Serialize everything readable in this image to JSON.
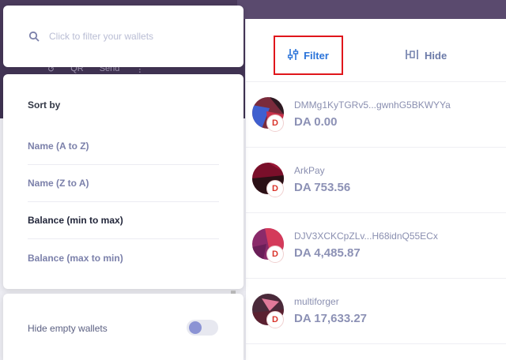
{
  "search": {
    "placeholder": "Click to filter your wallets"
  },
  "background": {
    "actions": [
      "↺",
      "QR",
      "Send",
      "⋮"
    ]
  },
  "toolbar": {
    "filter_label": "Filter",
    "hide_label": "Hide"
  },
  "sort": {
    "title": "Sort by",
    "options": [
      {
        "label": "Name (A to Z)",
        "active": false
      },
      {
        "label": "Name (Z to A)",
        "active": false
      },
      {
        "label": "Balance (min to max)",
        "active": true
      },
      {
        "label": "Balance (max to min)",
        "active": false
      }
    ]
  },
  "hide_empty": {
    "label": "Hide empty wallets",
    "enabled": false
  },
  "wallets": [
    {
      "name": "DMMg1KyTGRv5...gwnhG5BKWYYa",
      "balance": "DA 0.00",
      "badge": "D"
    },
    {
      "name": "ArkPay",
      "balance": "DA 753.56",
      "badge": "D"
    },
    {
      "name": "DJV3XCKCpZLv...H68idnQ55ECx",
      "balance": "DA 4,485.87",
      "badge": "D"
    },
    {
      "name": "multiforger",
      "balance": "DA 17,633.27",
      "badge": "D"
    }
  ],
  "colors": {
    "accent": "#2a73d9",
    "highlight_border": "#e0161b",
    "toggle_knob": "#8b93d4"
  }
}
